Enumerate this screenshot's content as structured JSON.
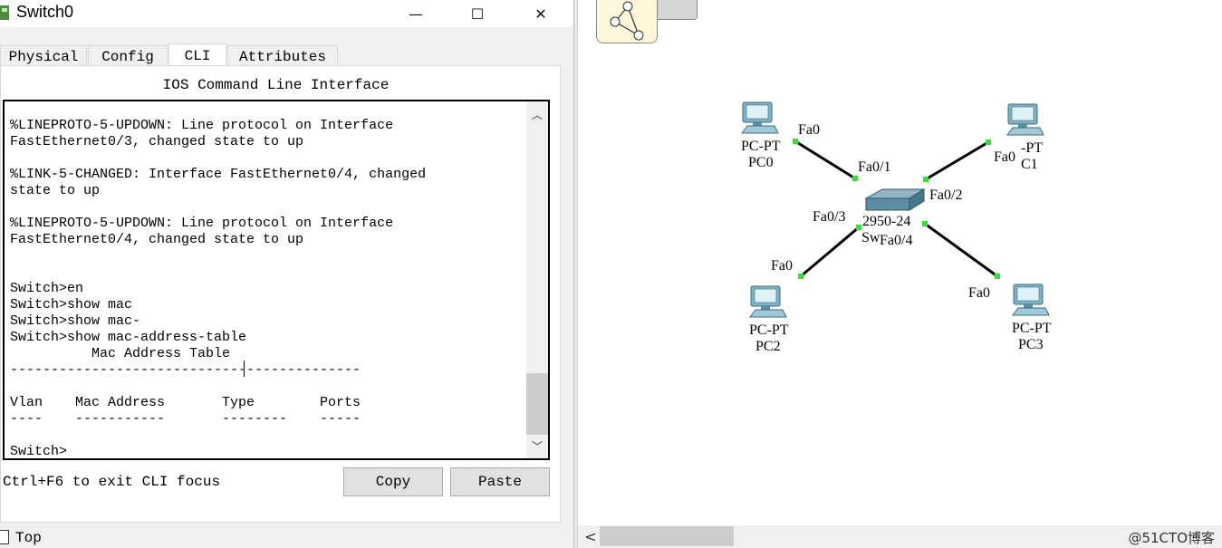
{
  "window": {
    "title": "Switch0",
    "controls": {
      "minimize": "—",
      "maximize": "☐",
      "close": "✕"
    },
    "tabs": [
      {
        "label": "Physical",
        "active": false
      },
      {
        "label": "Config",
        "active": false
      },
      {
        "label": "CLI",
        "active": true
      },
      {
        "label": "Attributes",
        "active": false
      }
    ],
    "cli": {
      "heading": "IOS Command Line Interface",
      "lines": [
        "%LINEPROTO-5-UPDOWN: Line protocol on Interface",
        "FastEthernet0/3, changed state to up",
        "",
        "%LINK-5-CHANGED: Interface FastEthernet0/4, changed",
        "state to up",
        "",
        "%LINEPROTO-5-UPDOWN: Line protocol on Interface",
        "FastEthernet0/4, changed state to up",
        "",
        "",
        "Switch>en",
        "Switch>show mac",
        "Switch>show mac-",
        "Switch>show mac-address-table",
        "          Mac Address Table",
        "-------------------------------------------",
        "",
        "Vlan    Mac Address       Type        Ports",
        "----    -----------       --------    -----",
        "",
        "Switch>"
      ]
    },
    "focus_hint": "Ctrl+F6 to exit CLI focus",
    "copy_label": "Copy",
    "paste_label": "Paste",
    "top_label": "Top"
  },
  "topology": {
    "switch": {
      "model": "2950-24",
      "name": "Sw"
    },
    "pcs": [
      {
        "type": "PC-PT",
        "name": "PC0"
      },
      {
        "type": "-PT",
        "name": "C1"
      },
      {
        "type": "PC-PT",
        "name": "PC2"
      },
      {
        "type": "PC-PT",
        "name": "PC3"
      }
    ],
    "ports": {
      "pc0": "Fa0",
      "pc1": "Fa0",
      "pc2": "Fa0",
      "pc3": "Fa0",
      "sw1": "Fa0/1",
      "sw2": "Fa0/2",
      "sw3": "Fa0/3",
      "sw4": "Fa0/4"
    },
    "link_light_color": "#33e033"
  },
  "watermark": "@51CTO博客"
}
